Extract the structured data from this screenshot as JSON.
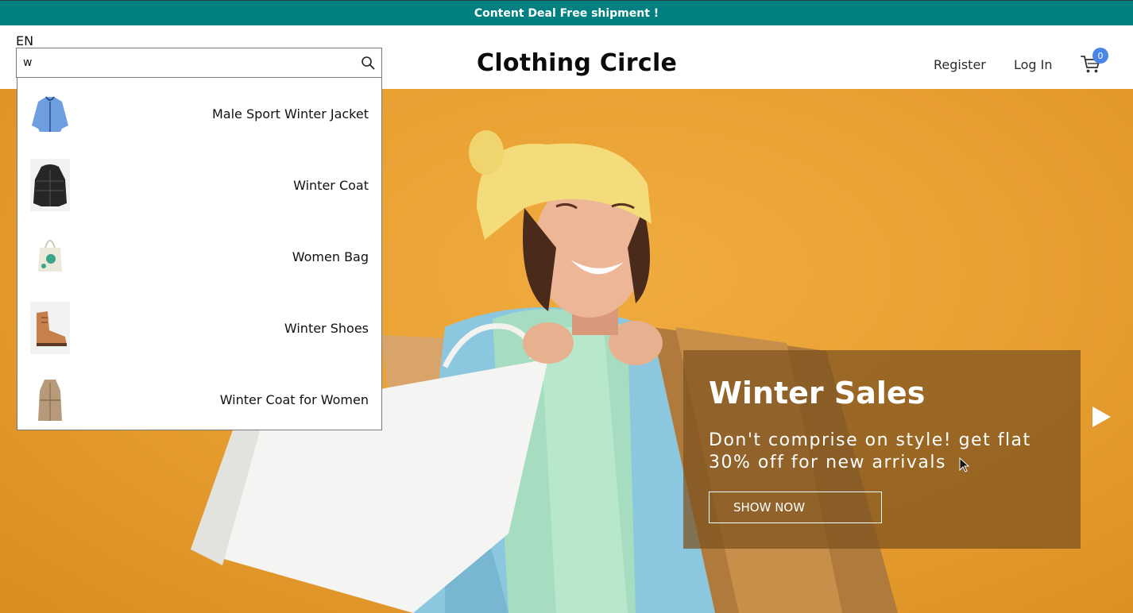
{
  "announcement": "Content Deal Free shipment !",
  "header": {
    "language": "EN",
    "search": {
      "value": "w",
      "placeholder": ""
    },
    "logo": "Clothing Circle",
    "register": "Register",
    "login": "Log In",
    "cart_count": "0"
  },
  "search_results": [
    {
      "name": "Male Sport Winter Jacket",
      "icon": "blue-jacket-thumbnail"
    },
    {
      "name": "Winter Coat",
      "icon": "black-puffer-coat-thumbnail"
    },
    {
      "name": "Women Bag",
      "icon": "tote-bag-thumbnail"
    },
    {
      "name": "Winter Shoes",
      "icon": "brown-boot-thumbnail"
    },
    {
      "name": "Winter Coat for Women",
      "icon": "trench-coat-thumbnail"
    }
  ],
  "hero": {
    "title": "Winter Sales",
    "text": "Don't comprise on style! get flat 30% off for new arrivals",
    "button": "SHOW NOW"
  },
  "colors": {
    "announcement_bg": "#008080",
    "hero_bg": "#e9a033",
    "badge": "#4a86e8",
    "promo_panel": "#7c521e"
  }
}
